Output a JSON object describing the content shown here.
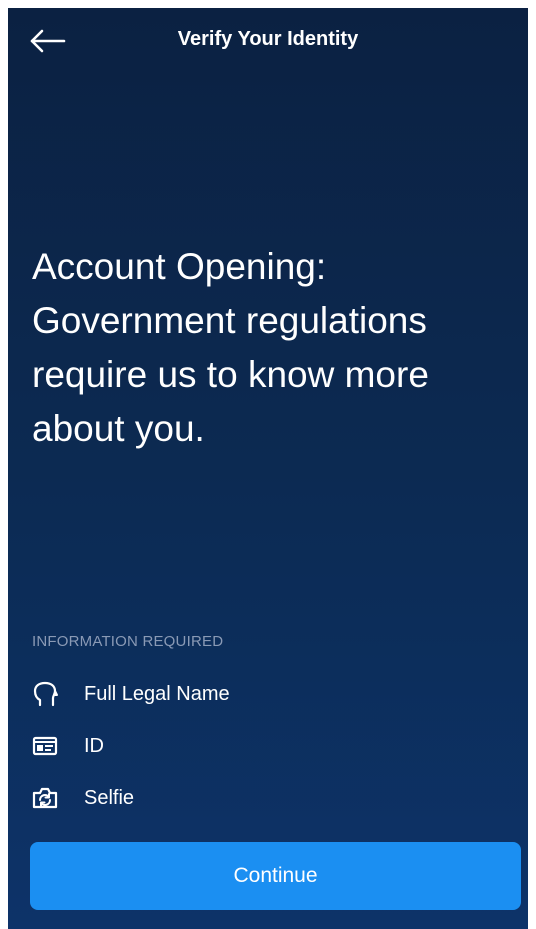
{
  "header": {
    "title": "Verify Your Identity",
    "back_icon": "arrow-left-icon"
  },
  "main": {
    "headline": "Account Opening: Government regulations require us to know more about you."
  },
  "requirements": {
    "section_label": "INFORMATION REQUIRED",
    "items": [
      {
        "icon": "head-profile-icon",
        "label": "Full Legal Name"
      },
      {
        "icon": "id-card-icon",
        "label": "ID"
      },
      {
        "icon": "camera-switch-icon",
        "label": "Selfie"
      }
    ]
  },
  "footer": {
    "continue_label": "Continue"
  },
  "colors": {
    "background_top": "#0b2142",
    "background_bottom": "#0d3369",
    "accent": "#1b8ff2",
    "muted_label": "#8a9ab5"
  }
}
